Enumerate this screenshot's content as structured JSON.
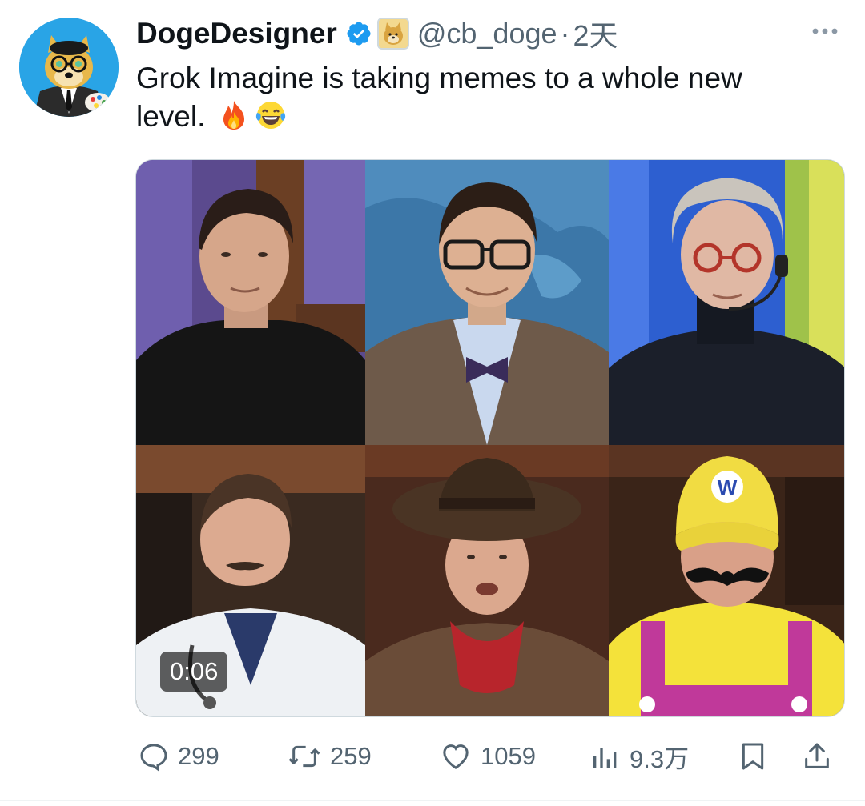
{
  "tweet": {
    "display_name": "DogeDesigner",
    "handle": "@cb_doge",
    "separator": "·",
    "time": "2天",
    "text_line1": "Grok Imagine is taking memes to a whole new",
    "text_line2": "level.",
    "emojis": [
      "fire-emoji",
      "laughing-tears-emoji"
    ],
    "icons": {
      "verified": "verified-badge-icon",
      "affiliate": "doge-affiliate-badge",
      "more": "more-options-icon"
    }
  },
  "media": {
    "type": "video",
    "duration": "0:06",
    "tiles": [
      "person-black-sweater",
      "person-glasses-bowtie",
      "person-gray-hair-headset",
      "person-doctor-beard",
      "person-cowboy-hat",
      "person-wario-costume"
    ]
  },
  "actions": {
    "reply_count": "299",
    "retweet_count": "259",
    "like_count": "1059",
    "views_count": "9.3万"
  },
  "colors": {
    "text_primary": "#0f1419",
    "text_secondary": "#536471",
    "verified_blue": "#1d9bf0",
    "border": "#cfd9de"
  }
}
